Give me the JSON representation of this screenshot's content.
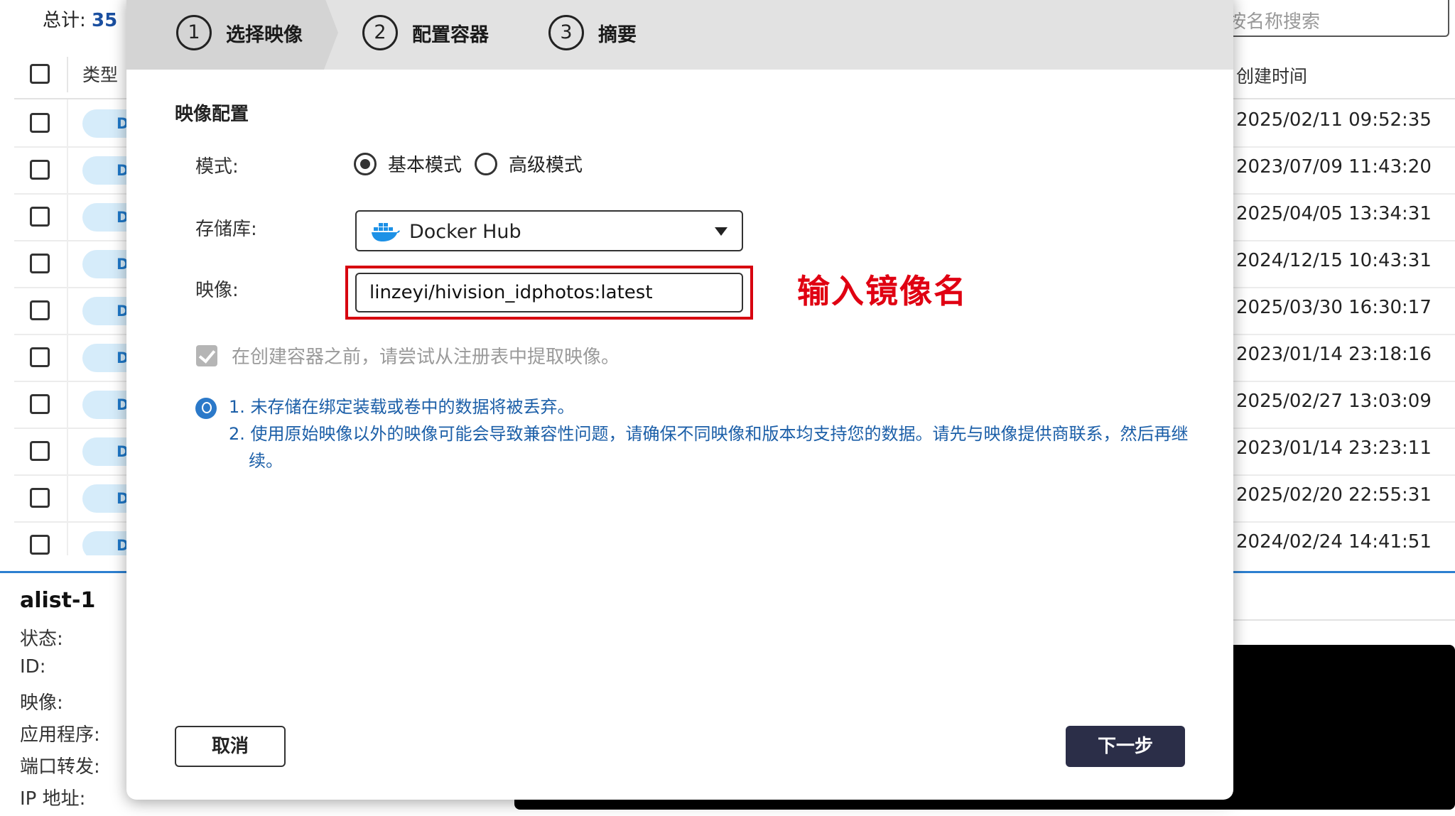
{
  "background": {
    "total_label": "总计:",
    "total_count": "35",
    "search_placeholder": "按名称搜索",
    "columns": {
      "type": "类型",
      "created": "创建时间"
    },
    "rows": [
      {
        "type": "DO",
        "created": "2025/02/11 09:52:35"
      },
      {
        "type": "DO",
        "created": "2023/07/09 11:43:20"
      },
      {
        "type": "DO",
        "created": "2025/04/05 13:34:31"
      },
      {
        "type": "DO",
        "created": "2024/12/15 10:43:31"
      },
      {
        "type": "DO",
        "created": "2025/03/30 16:30:17"
      },
      {
        "type": "DO",
        "created": "2023/01/14 23:18:16"
      },
      {
        "type": "DO",
        "created": "2025/02/27 13:03:09"
      },
      {
        "type": "DO",
        "created": "2023/01/14 23:23:11"
      },
      {
        "type": "DO",
        "created": "2025/02/20 22:55:31"
      },
      {
        "type": "DO",
        "created": "2024/02/24 14:41:51"
      }
    ],
    "detail": {
      "name": "alist-1",
      "labels": [
        "状态:",
        "ID:",
        "映像:",
        "应用程序:",
        "端口转发:",
        "IP 地址:"
      ]
    }
  },
  "wizard": {
    "steps": [
      {
        "num": "1",
        "label": "选择映像"
      },
      {
        "num": "2",
        "label": "配置容器"
      },
      {
        "num": "3",
        "label": "摘要"
      }
    ],
    "section_title": "映像配置",
    "mode": {
      "label": "模式:",
      "options": [
        "基本模式",
        "高级模式"
      ],
      "selected": "基本模式"
    },
    "registry": {
      "label": "存储库:",
      "value": "Docker Hub",
      "icon": "docker-whale-icon"
    },
    "image": {
      "label": "映像:",
      "value": "linzeyi/hivision_idphotos:latest"
    },
    "annotation": "输入镜像名",
    "pull_checkbox": {
      "label": "在创建容器之前，请尝试从注册表中提取映像。",
      "checked": true,
      "disabled": true
    },
    "notes": [
      "1. 未存储在绑定装载或卷中的数据将被丢弃。",
      "2. 使用原始映像以外的映像可能会导致兼容性问题，请确保不同映像和版本均支持您的数据。请先与映像提供商联系，然后再继续。"
    ],
    "buttons": {
      "cancel": "取消",
      "next": "下一步"
    }
  },
  "colors": {
    "accent_blue": "#2c7fd0",
    "primary_button": "#2b2e48",
    "annotation_red": "#e00012",
    "info_text": "#1c5fa8"
  }
}
